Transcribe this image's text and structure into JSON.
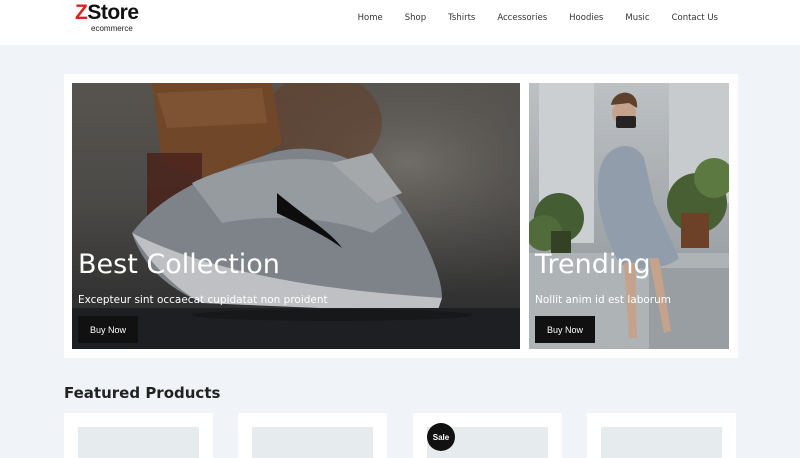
{
  "brand": {
    "name_first": "Z",
    "name_rest": "Store",
    "tagline": "ecommerce"
  },
  "nav": {
    "items": [
      "Home",
      "Shop",
      "Tshirts",
      "Accessories",
      "Hoodies",
      "Music",
      "Contact Us"
    ]
  },
  "hero": {
    "left": {
      "title": "Best Collection",
      "subtitle": "Excepteur sint occaecat cupidatat non proident",
      "button": "Buy Now"
    },
    "right": {
      "title": "Trending",
      "subtitle": "Nollit anim id est laborum",
      "button": "Buy Now"
    }
  },
  "featured": {
    "title": "Featured Products",
    "badge": "Sale"
  }
}
